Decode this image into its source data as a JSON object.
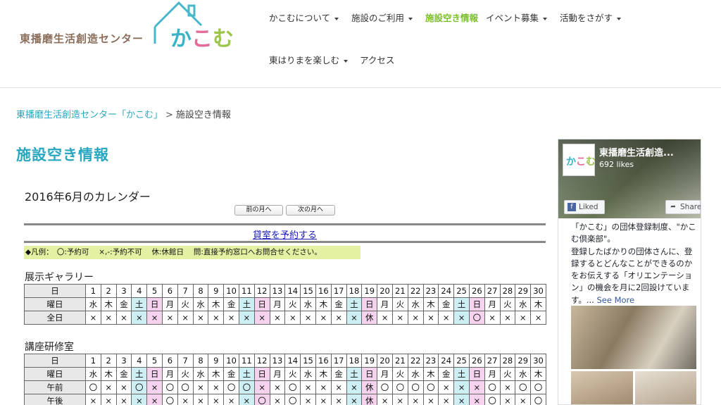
{
  "site": {
    "logo_text": "東播磨生活創造センター",
    "logo_kana": [
      "か",
      "こ",
      "む"
    ]
  },
  "nav": {
    "items": [
      {
        "label": "かこむについて"
      },
      {
        "label": "施設のご利用"
      },
      {
        "label": "施設空き情報"
      },
      {
        "label": "イベント募集"
      },
      {
        "label": "活動をさがす"
      },
      {
        "label": "東はりまを楽しむ"
      },
      {
        "label": "アクセス"
      }
    ]
  },
  "breadcrumb": {
    "home": "東播磨生活創造センター「かこむ」",
    "sep": ">",
    "current": "施設空き情報"
  },
  "page_title": "施設空き情報",
  "calendar": {
    "title": "2016年6月のカレンダー",
    "prev_label": "前の月へ",
    "next_label": "次の月へ",
    "reserve_link": "貸室を予約する",
    "legend": "◆凡例：　〇:予約可　 ×,-:予約不可　 休:休館日　 問:直接予約窓口へお問合せください。",
    "day_label": "日",
    "dow_label": "曜日",
    "days": [
      "1",
      "2",
      "3",
      "4",
      "5",
      "6",
      "7",
      "8",
      "9",
      "10",
      "11",
      "12",
      "13",
      "14",
      "15",
      "16",
      "17",
      "18",
      "19",
      "20",
      "21",
      "22",
      "23",
      "24",
      "25",
      "26",
      "27",
      "28",
      "29",
      "30"
    ],
    "dow": [
      "水",
      "木",
      "金",
      "土",
      "日",
      "月",
      "火",
      "水",
      "木",
      "金",
      "土",
      "日",
      "月",
      "火",
      "水",
      "木",
      "金",
      "土",
      "日",
      "月",
      "火",
      "水",
      "木",
      "金",
      "土",
      "日",
      "月",
      "火",
      "水",
      "木"
    ],
    "rooms": [
      {
        "name": "展示ギャラリー",
        "rows": [
          {
            "label": "全日",
            "cells": [
              "×",
              "×",
              "×",
              "×",
              "×",
              "×",
              "×",
              "×",
              "×",
              "×",
              "×",
              "×",
              "×",
              "×",
              "×",
              "×",
              "×",
              "×",
              "休",
              "×",
              "×",
              "×",
              "×",
              "×",
              "×",
              "〇",
              "×",
              "×",
              "×",
              "×"
            ]
          }
        ]
      },
      {
        "name": "講座研修室",
        "rows": [
          {
            "label": "午前",
            "cells": [
              "〇",
              "×",
              "×",
              "〇",
              "×",
              "〇",
              "〇",
              "×",
              "×",
              "〇",
              "〇",
              "×",
              "×",
              "〇",
              "×",
              "×",
              "×",
              "×",
              "休",
              "〇",
              "〇",
              "〇",
              "〇",
              "×",
              "×",
              "×",
              "〇",
              "×",
              "〇",
              "〇"
            ]
          },
          {
            "label": "午後",
            "cells": [
              "×",
              "×",
              "×",
              "×",
              "×",
              "〇",
              "×",
              "×",
              "×",
              "×",
              "×",
              "〇",
              "×",
              "〇",
              "×",
              "×",
              "×",
              "×",
              "休",
              "×",
              "×",
              "×",
              "×",
              "×",
              "×",
              "×",
              "〇",
              "×",
              "×",
              "〇"
            ]
          }
        ]
      }
    ]
  },
  "facebook": {
    "page_name": "東播磨生活創造...",
    "likes": "692 likes",
    "liked_label": "Liked",
    "share_label": "Share",
    "post_text": "「かこむ」の団体登録制度、\"かこむ倶楽部\"。\n登録したばかりの団体さんに、登録するとどんなことができるのかをお伝えする「オリエンテーション」の機会を月に2回設けています。...",
    "see_more": "See More"
  }
}
